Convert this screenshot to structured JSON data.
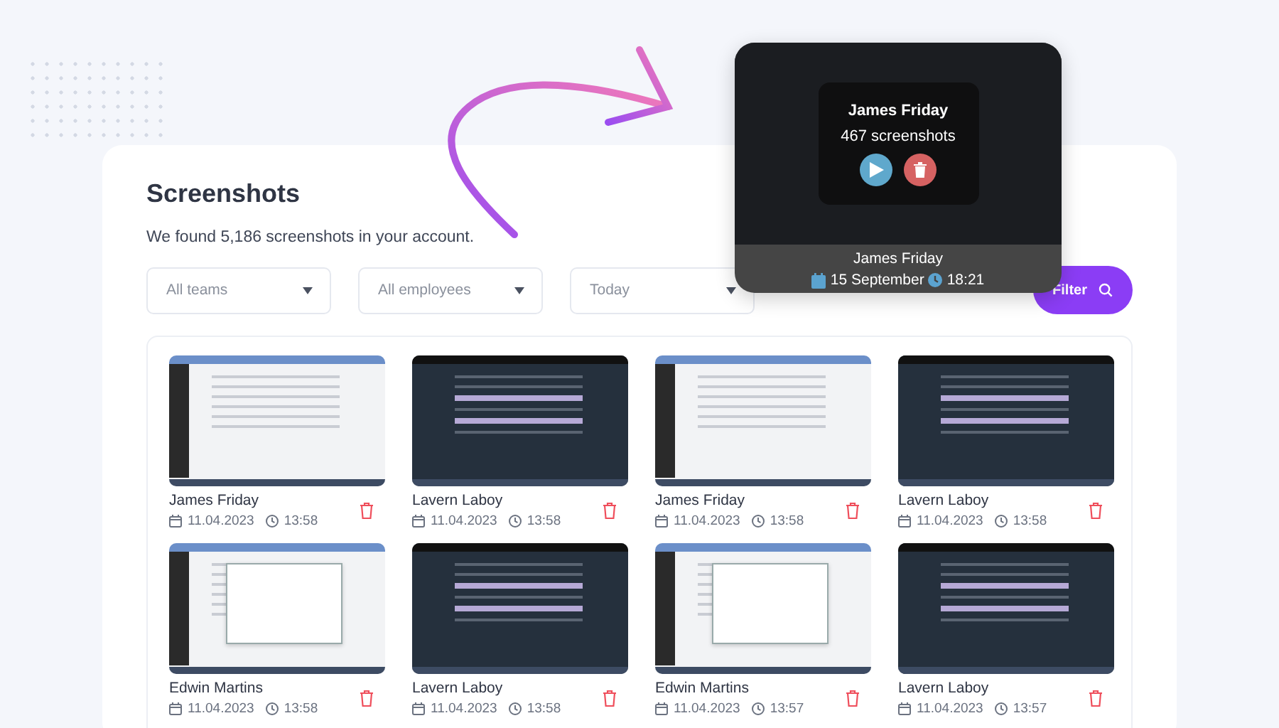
{
  "page": {
    "title": "Screenshots",
    "summary": "We found 5,186 screenshots in your account."
  },
  "filters": [
    {
      "placeholder": "All teams"
    },
    {
      "placeholder": "All employees"
    },
    {
      "placeholder": "Today"
    }
  ],
  "filter_button": {
    "label": "Filter"
  },
  "screenshots": [
    {
      "kind": "light",
      "name": "James Friday",
      "date": "11.04.2023",
      "time": "13:58"
    },
    {
      "kind": "dark",
      "name": "Lavern Laboy",
      "date": "11.04.2023",
      "time": "13:58"
    },
    {
      "kind": "light",
      "name": "James Friday",
      "date": "11.04.2023",
      "time": "13:58"
    },
    {
      "kind": "dark",
      "name": "Lavern Laboy",
      "date": "11.04.2023",
      "time": "13:58"
    },
    {
      "kind": "dialog",
      "name": "Edwin Martins",
      "date": "11.04.2023",
      "time": "13:58"
    },
    {
      "kind": "dark",
      "name": "Lavern Laboy",
      "date": "11.04.2023",
      "time": "13:58"
    },
    {
      "kind": "dialog",
      "name": "Edwin Martins",
      "date": "11.04.2023",
      "time": "13:57"
    },
    {
      "kind": "dark",
      "name": "Lavern Laboy",
      "date": "11.04.2023",
      "time": "13:57"
    }
  ],
  "preview": {
    "overlay_name": "James Friday",
    "overlay_count": "467 screenshots",
    "name": "James Friday",
    "date": "15 September",
    "time": "18:21"
  }
}
